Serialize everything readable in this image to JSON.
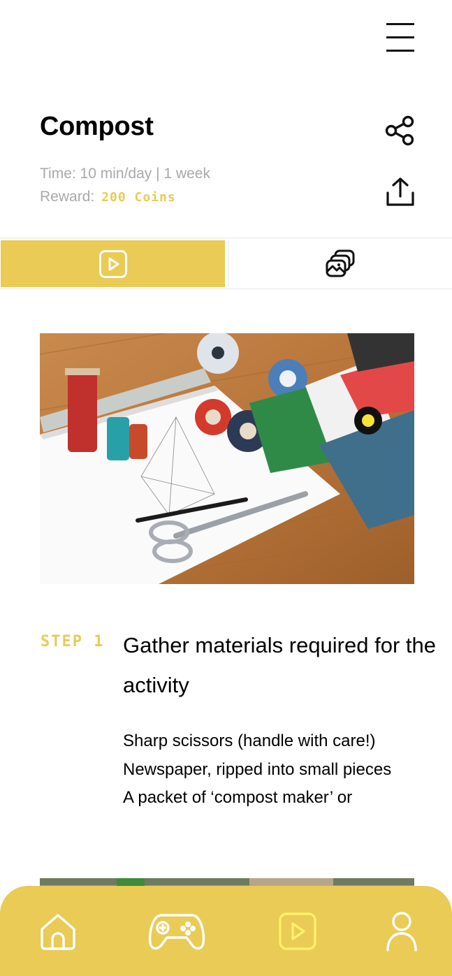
{
  "header": {
    "title": "Compost",
    "time_text": "Time: 10 min/day | 1 week",
    "reward_label": "Reward:",
    "reward_value": "200 Coins"
  },
  "icons": {
    "menu": "hamburger-menu-icon",
    "share": "share-icon",
    "export": "upload-icon",
    "video_tab": "play-icon",
    "gallery_tab": "images-icon",
    "nav_home": "home-icon",
    "nav_games": "gamepad-icon",
    "nav_videos": "play-icon",
    "nav_profile": "user-icon"
  },
  "tabs": [
    {
      "name": "video",
      "active": true
    },
    {
      "name": "gallery",
      "active": false
    }
  ],
  "steps": [
    {
      "label": "STEP 1",
      "title": "Gather materials required for the activity",
      "materials": [
        "Sharp scissors (handle with care!)",
        "Newspaper, ripped into small pieces",
        "A packet of ‘compost maker’ or"
      ]
    }
  ],
  "colors": {
    "accent": "#e9cb55",
    "muted_text": "#a9a9a9",
    "active_nav_icon": "#fff06a"
  }
}
